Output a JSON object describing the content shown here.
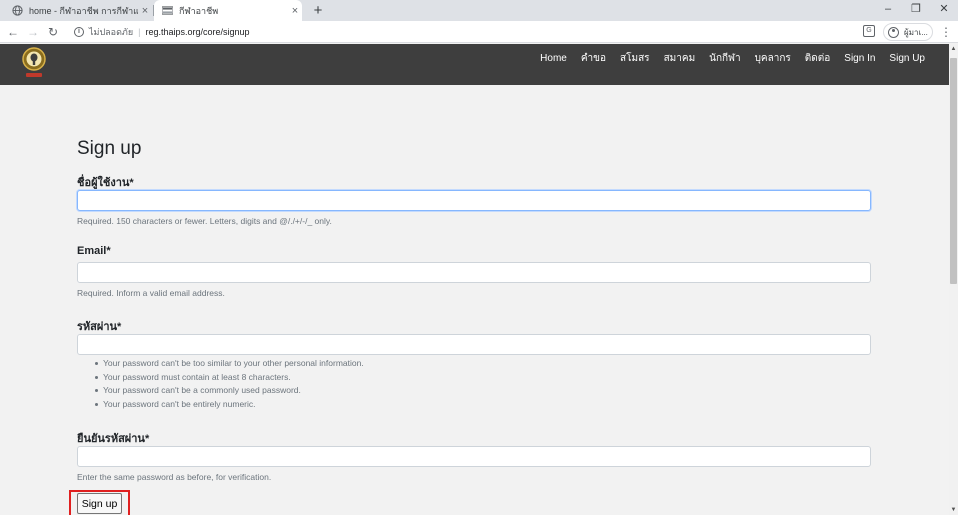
{
  "browser": {
    "tabs": [
      {
        "title": "home - กีฬาอาชีพ การกีฬาแห่งประเทศไทย",
        "active": false
      },
      {
        "title": "กีฬาอาชีพ",
        "active": true
      }
    ],
    "new_tab": "+",
    "window_controls": {
      "minimize": "–",
      "restore": "❐",
      "close": "✕"
    },
    "nav": {
      "back": "←",
      "forward": "→",
      "reload": "↻"
    },
    "security_label": "ไม่ปลอดภัย",
    "omnibox_separator": "|",
    "url": "reg.thaips.org/core/signup",
    "profile_label": "ผู้มาเ...",
    "menu": "⋮"
  },
  "site_nav": {
    "links": [
      "Home",
      "คำขอ",
      "สโมสร",
      "สมาคม",
      "นักกีฬา",
      "บุคลากร",
      "ติดต่อ",
      "Sign In",
      "Sign Up"
    ]
  },
  "form": {
    "title": "Sign up",
    "username": {
      "label": "ชื่อผู้ใช้งาน*",
      "value": "",
      "help": "Required. 150 characters or fewer. Letters, digits and @/./+/-/_ only."
    },
    "email": {
      "label": "Email*",
      "value": "",
      "help": "Required. Inform a valid email address."
    },
    "password": {
      "label": "รหัสผ่าน*",
      "value": "",
      "help_items": [
        "Your password can't be too similar to your other personal information.",
        "Your password must contain at least 8 characters.",
        "Your password can't be a commonly used password.",
        "Your password can't be entirely numeric."
      ]
    },
    "password_confirm": {
      "label": "ยืนยันรหัสผ่าน*",
      "value": "",
      "help": "Enter the same password as before, for verification."
    },
    "submit_label": "Sign up"
  },
  "colors": {
    "nav_background": "#3e3e3e",
    "page_background": "#f2f2f2",
    "highlight_outline": "#e02020",
    "focus_border": "#86b7fe"
  },
  "scrollbar": {
    "up": "▲",
    "down": "▼"
  }
}
